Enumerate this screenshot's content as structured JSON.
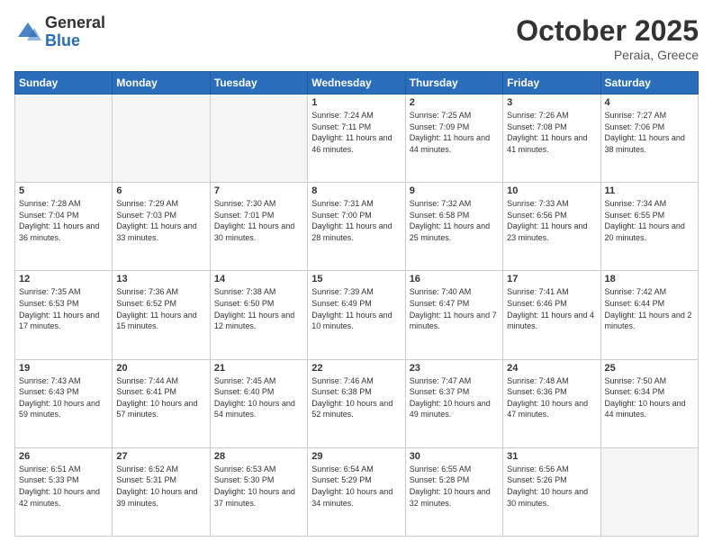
{
  "header": {
    "logo_line1": "General",
    "logo_line2": "Blue",
    "month": "October 2025",
    "location": "Peraia, Greece"
  },
  "days_of_week": [
    "Sunday",
    "Monday",
    "Tuesday",
    "Wednesday",
    "Thursday",
    "Friday",
    "Saturday"
  ],
  "weeks": [
    [
      {
        "day": "",
        "info": ""
      },
      {
        "day": "",
        "info": ""
      },
      {
        "day": "",
        "info": ""
      },
      {
        "day": "1",
        "info": "Sunrise: 7:24 AM\nSunset: 7:11 PM\nDaylight: 11 hours and 46 minutes."
      },
      {
        "day": "2",
        "info": "Sunrise: 7:25 AM\nSunset: 7:09 PM\nDaylight: 11 hours and 44 minutes."
      },
      {
        "day": "3",
        "info": "Sunrise: 7:26 AM\nSunset: 7:08 PM\nDaylight: 11 hours and 41 minutes."
      },
      {
        "day": "4",
        "info": "Sunrise: 7:27 AM\nSunset: 7:06 PM\nDaylight: 11 hours and 38 minutes."
      }
    ],
    [
      {
        "day": "5",
        "info": "Sunrise: 7:28 AM\nSunset: 7:04 PM\nDaylight: 11 hours and 36 minutes."
      },
      {
        "day": "6",
        "info": "Sunrise: 7:29 AM\nSunset: 7:03 PM\nDaylight: 11 hours and 33 minutes."
      },
      {
        "day": "7",
        "info": "Sunrise: 7:30 AM\nSunset: 7:01 PM\nDaylight: 11 hours and 30 minutes."
      },
      {
        "day": "8",
        "info": "Sunrise: 7:31 AM\nSunset: 7:00 PM\nDaylight: 11 hours and 28 minutes."
      },
      {
        "day": "9",
        "info": "Sunrise: 7:32 AM\nSunset: 6:58 PM\nDaylight: 11 hours and 25 minutes."
      },
      {
        "day": "10",
        "info": "Sunrise: 7:33 AM\nSunset: 6:56 PM\nDaylight: 11 hours and 23 minutes."
      },
      {
        "day": "11",
        "info": "Sunrise: 7:34 AM\nSunset: 6:55 PM\nDaylight: 11 hours and 20 minutes."
      }
    ],
    [
      {
        "day": "12",
        "info": "Sunrise: 7:35 AM\nSunset: 6:53 PM\nDaylight: 11 hours and 17 minutes."
      },
      {
        "day": "13",
        "info": "Sunrise: 7:36 AM\nSunset: 6:52 PM\nDaylight: 11 hours and 15 minutes."
      },
      {
        "day": "14",
        "info": "Sunrise: 7:38 AM\nSunset: 6:50 PM\nDaylight: 11 hours and 12 minutes."
      },
      {
        "day": "15",
        "info": "Sunrise: 7:39 AM\nSunset: 6:49 PM\nDaylight: 11 hours and 10 minutes."
      },
      {
        "day": "16",
        "info": "Sunrise: 7:40 AM\nSunset: 6:47 PM\nDaylight: 11 hours and 7 minutes."
      },
      {
        "day": "17",
        "info": "Sunrise: 7:41 AM\nSunset: 6:46 PM\nDaylight: 11 hours and 4 minutes."
      },
      {
        "day": "18",
        "info": "Sunrise: 7:42 AM\nSunset: 6:44 PM\nDaylight: 11 hours and 2 minutes."
      }
    ],
    [
      {
        "day": "19",
        "info": "Sunrise: 7:43 AM\nSunset: 6:43 PM\nDaylight: 10 hours and 59 minutes."
      },
      {
        "day": "20",
        "info": "Sunrise: 7:44 AM\nSunset: 6:41 PM\nDaylight: 10 hours and 57 minutes."
      },
      {
        "day": "21",
        "info": "Sunrise: 7:45 AM\nSunset: 6:40 PM\nDaylight: 10 hours and 54 minutes."
      },
      {
        "day": "22",
        "info": "Sunrise: 7:46 AM\nSunset: 6:38 PM\nDaylight: 10 hours and 52 minutes."
      },
      {
        "day": "23",
        "info": "Sunrise: 7:47 AM\nSunset: 6:37 PM\nDaylight: 10 hours and 49 minutes."
      },
      {
        "day": "24",
        "info": "Sunrise: 7:48 AM\nSunset: 6:36 PM\nDaylight: 10 hours and 47 minutes."
      },
      {
        "day": "25",
        "info": "Sunrise: 7:50 AM\nSunset: 6:34 PM\nDaylight: 10 hours and 44 minutes."
      }
    ],
    [
      {
        "day": "26",
        "info": "Sunrise: 6:51 AM\nSunset: 5:33 PM\nDaylight: 10 hours and 42 minutes."
      },
      {
        "day": "27",
        "info": "Sunrise: 6:52 AM\nSunset: 5:31 PM\nDaylight: 10 hours and 39 minutes."
      },
      {
        "day": "28",
        "info": "Sunrise: 6:53 AM\nSunset: 5:30 PM\nDaylight: 10 hours and 37 minutes."
      },
      {
        "day": "29",
        "info": "Sunrise: 6:54 AM\nSunset: 5:29 PM\nDaylight: 10 hours and 34 minutes."
      },
      {
        "day": "30",
        "info": "Sunrise: 6:55 AM\nSunset: 5:28 PM\nDaylight: 10 hours and 32 minutes."
      },
      {
        "day": "31",
        "info": "Sunrise: 6:56 AM\nSunset: 5:26 PM\nDaylight: 10 hours and 30 minutes."
      },
      {
        "day": "",
        "info": ""
      }
    ]
  ]
}
